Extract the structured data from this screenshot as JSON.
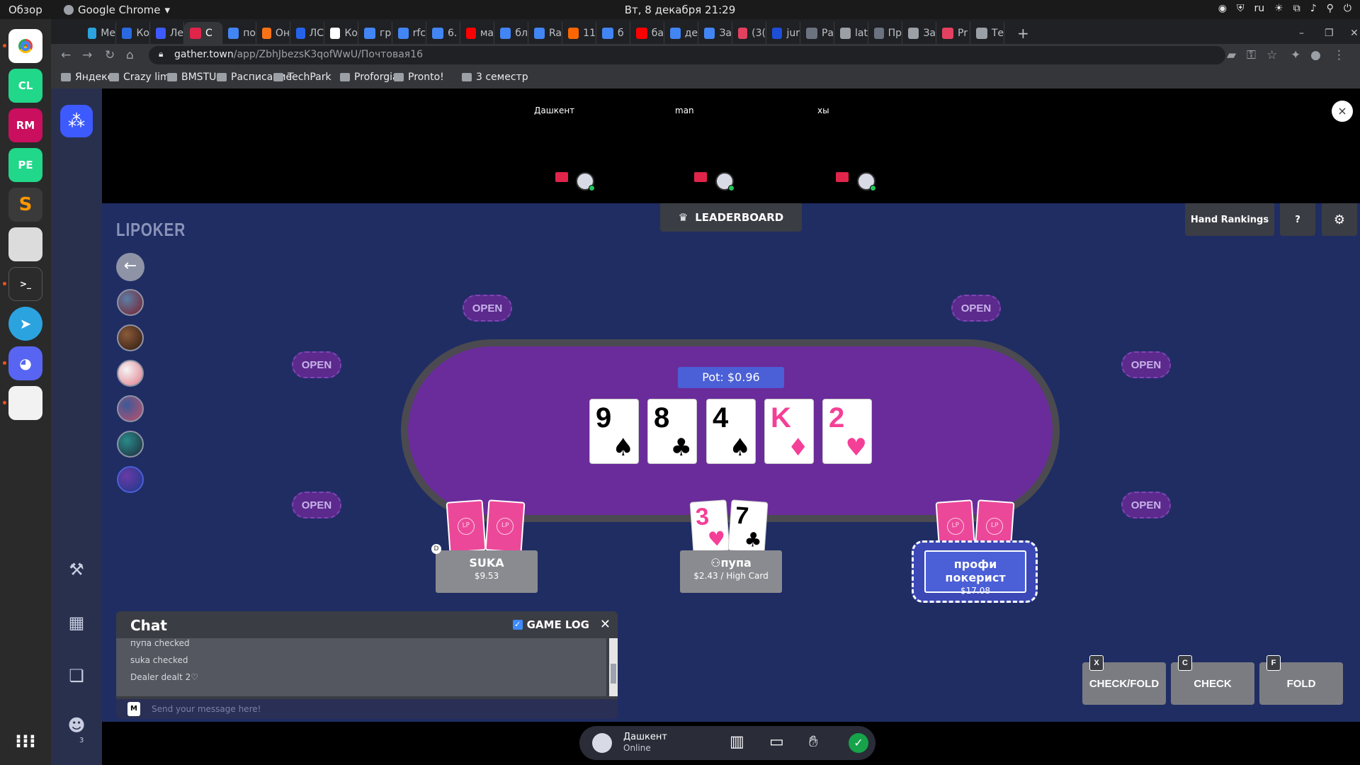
{
  "os": {
    "overview": "Обзор",
    "app_name": "Google Chrome",
    "clock": "Вт, 8 декабря  21:29",
    "lang": "ru"
  },
  "browser": {
    "tabs": [
      "Ме",
      "Ко",
      "Ле",
      "С",
      "по",
      "Он",
      "ЛС",
      "Ко",
      "гр",
      "rfc",
      "6.",
      "ма",
      "бл",
      "Ra",
      "11",
      "б",
      "ба",
      "де",
      "За",
      "(3(",
      "jur",
      "Ра",
      "lat",
      "Пр",
      "За",
      "Pr",
      "Те"
    ],
    "host": "gather.town",
    "path": "/app/ZbhJbezsK3qofWwU/Почтовая16"
  },
  "bookmarks": [
    "Яндекс",
    "Crazy lime",
    "BMSTU",
    "Расписание",
    "TechPark",
    "Proforgia",
    "Pronto!",
    "3 семестр"
  ],
  "video": {
    "participants": [
      "Дашкент",
      "man",
      "хы"
    ]
  },
  "game": {
    "brand": "LIPOKER",
    "leaderboard": "LEADERBOARD",
    "hand_rankings": "Hand Rankings",
    "help": "?",
    "open_label": "OPEN",
    "pot": "Pot: $0.96",
    "community": [
      {
        "rank": "9",
        "suit": "♠",
        "color": "black"
      },
      {
        "rank": "8",
        "suit": "♣",
        "color": "black"
      },
      {
        "rank": "4",
        "suit": "♠",
        "color": "black"
      },
      {
        "rank": "K",
        "suit": "♦",
        "color": "pink"
      },
      {
        "rank": "2",
        "suit": "♥",
        "color": "pink"
      }
    ],
    "card_back_logo": "LP",
    "players": {
      "suka": {
        "name": "SUKA",
        "stack": "$9.53",
        "dealer": "D"
      },
      "pupa": {
        "name": "пупа",
        "stack": "$2.43 / High Card",
        "hand": [
          {
            "rank": "3",
            "suit": "♥"
          },
          {
            "rank": "7",
            "suit": "♣"
          }
        ]
      },
      "me": {
        "name": "профи покерист",
        "stack": "$17.08"
      }
    },
    "chat": {
      "title": "Chat",
      "game_log": "GAME LOG",
      "log": [
        "пупа checked",
        "suka checked",
        "Dealer dealt 2♡"
      ],
      "key": "M",
      "placeholder": "Send your message here!"
    },
    "actions": [
      {
        "key": "X",
        "label": "CHECK/FOLD"
      },
      {
        "key": "C",
        "label": "CHECK"
      },
      {
        "key": "F",
        "label": "FOLD"
      }
    ]
  },
  "status": {
    "name": "Дашкент",
    "state": "Online",
    "people_count": "3"
  },
  "colors": {
    "felt": "#6a2c9a",
    "background": "#1f2d63",
    "accent": "#4b5fd6",
    "card_back": "#ec4899"
  }
}
